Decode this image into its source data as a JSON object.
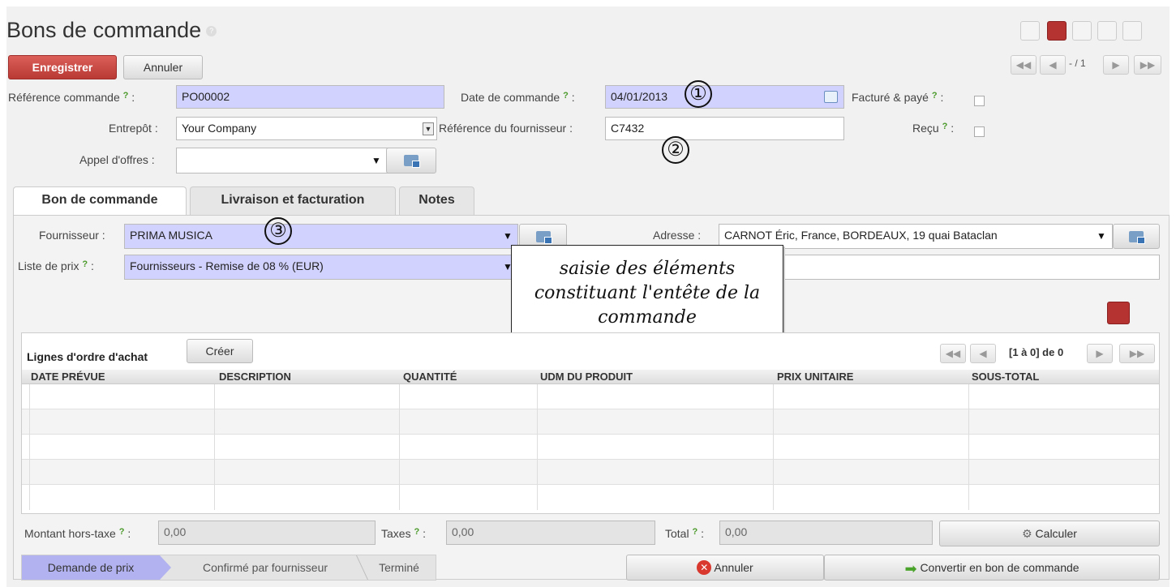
{
  "header": {
    "title": "Bons de commande",
    "help": "?"
  },
  "toolbar": {
    "save_label": "Enregistrer",
    "cancel_label": "Annuler",
    "pager_text": "- / 1"
  },
  "form": {
    "ref_label": "Référence commande",
    "ref_value": "PO00002",
    "date_label": "Date de commande",
    "date_value": "04/01/2013",
    "invoiced_label": "Facturé & payé",
    "warehouse_label": "Entrepôt :",
    "warehouse_value": "Your Company",
    "supplier_ref_label": "Référence du fournisseur :",
    "supplier_ref_value": "C7432",
    "received_label": "Reçu",
    "tender_label": "Appel d'offres :",
    "tender_value": "",
    "help": "?",
    "colon": ":"
  },
  "annotations": {
    "one": "①",
    "two": "②",
    "three": "③",
    "callout": "saisie des éléments constituant l'entête de la commande"
  },
  "tabs": [
    {
      "label": "Bon de commande"
    },
    {
      "label": "Livraison et facturation"
    },
    {
      "label": "Notes"
    }
  ],
  "order": {
    "supplier_label": "Fournisseur :",
    "supplier_value": "PRIMA MUSICA",
    "address_label": "Adresse :",
    "address_value": "CARNOT Éric, France, BORDEAUX, 19 quai Bataclan",
    "pricelist_label": "Liste de prix",
    "pricelist_value": "Fournisseurs - Remise de 08 % (EUR)"
  },
  "lines": {
    "title": "Lignes d'ordre d'achat",
    "create_label": "Créer",
    "pager_text": "[1 à 0] de 0",
    "columns": [
      "DATE PRÉVUE",
      "DESCRIPTION",
      "QUANTITÉ",
      "UDM DU PRODUIT",
      "PRIX UNITAIRE",
      "SOUS-TOTAL"
    ]
  },
  "totals": {
    "untaxed_label": "Montant hors-taxe",
    "untaxed_value": "0,00",
    "taxes_label": "Taxes",
    "taxes_value": "0,00",
    "total_label": "Total",
    "total_value": "0,00",
    "compute_label": "Calculer"
  },
  "status": {
    "stages": [
      "Demande de prix",
      "Confirmé par fournisseur",
      "Terminé"
    ],
    "active_stage": "Demande de prix"
  },
  "actions": {
    "cancel_label": "Annuler",
    "convert_label": "Convertir en bon de commande"
  },
  "colors": {
    "required_bg": "#d2d2ff",
    "save_red": "#c9463f",
    "view_active": "#b53331",
    "status_active": "#b2b2f0"
  }
}
